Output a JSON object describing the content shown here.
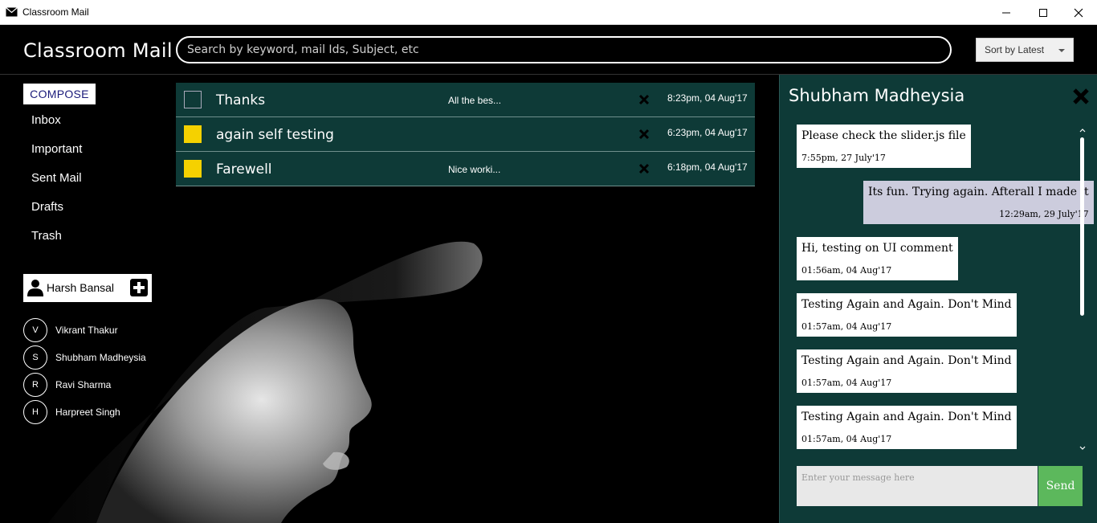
{
  "window": {
    "title": "Classroom Mail",
    "minimize_icon": "minimize-icon",
    "maximize_icon": "maximize-icon",
    "close_icon": "close-icon"
  },
  "header": {
    "brand": "Classroom Mail",
    "search_placeholder": "Search by keyword, mail Ids, Subject, etc",
    "sort_label": "Sort by Latest"
  },
  "sidebar": {
    "compose_label": "COMPOSE",
    "nav": [
      "Inbox",
      "Important",
      "Sent Mail",
      "Drafts",
      "Trash"
    ],
    "current_user": "Harsh Bansal",
    "contacts": [
      {
        "initial": "V",
        "name": "Vikrant Thakur"
      },
      {
        "initial": "S",
        "name": "Shubham Madheysia"
      },
      {
        "initial": "R",
        "name": "Ravi Sharma"
      },
      {
        "initial": "H",
        "name": "Harpreet Singh"
      }
    ]
  },
  "mails": [
    {
      "subject": "Thanks",
      "snippet": "All the bes...",
      "time": "8:23pm, 04 Aug'17",
      "checked": false
    },
    {
      "subject": "again self testing",
      "snippet": "",
      "time": "6:23pm, 04 Aug'17",
      "checked": true
    },
    {
      "subject": "Farewell",
      "snippet": "Nice worki...",
      "time": "6:18pm, 04 Aug'17",
      "checked": true
    }
  ],
  "chat": {
    "contact_name": "Shubham Madheysia",
    "messages": [
      {
        "text": "Please check the slider.js file",
        "time": "7:55pm, 27 July'17",
        "mine": false
      },
      {
        "text": "Its fun. Trying again. Afterall I made it",
        "time": "12:29am, 29 July'17",
        "mine": true
      },
      {
        "text": "Hi, testing on UI comment",
        "time": "01:56am, 04 Aug'17",
        "mine": false
      },
      {
        "text": "Testing Again and Again. Don't Mind",
        "time": "01:57am, 04 Aug'17",
        "mine": false
      },
      {
        "text": "Testing Again and Again. Don't Mind",
        "time": "01:57am, 04 Aug'17",
        "mine": false
      },
      {
        "text": "Testing Again and Again. Don't Mind",
        "time": "01:57am, 04 Aug'17",
        "mine": false
      }
    ],
    "input_placeholder": "Enter your message here",
    "send_label": "Send"
  },
  "colors": {
    "accent_teal": "#0e3a37",
    "checkbox_yellow": "#f5d100",
    "send_green": "#5cb85c",
    "own_message": "#ccccdd"
  }
}
